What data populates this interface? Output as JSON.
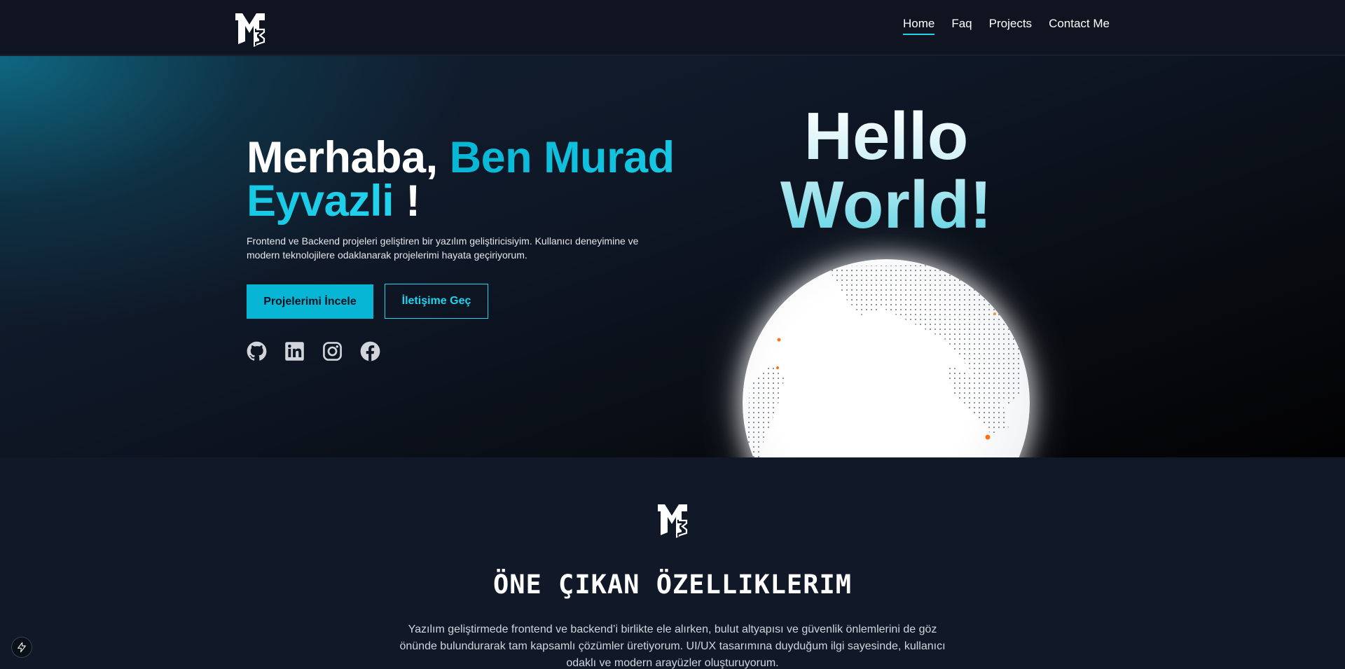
{
  "header": {
    "logo_icon": "mb-monogram-logo",
    "nav": [
      {
        "label": "Home",
        "active": true
      },
      {
        "label": "Faq",
        "active": false
      },
      {
        "label": "Projects",
        "active": false
      },
      {
        "label": "Contact Me",
        "active": false
      }
    ]
  },
  "hero": {
    "title_prefix": "Merhaba,",
    "title_name": "Ben Murad Eyvazli",
    "title_suffix": "!",
    "description": "Frontend ve Backend projeleri geliştiren bir yazılım geliştiricisiyim. Kullanıcı deneyimine ve modern teknolojilere odaklanarak projelerimi hayata geçiriyorum.",
    "primary_button": "Projelerimi İncele",
    "secondary_button": "İletişime Geç",
    "socials": [
      "github-icon",
      "linkedin-icon",
      "instagram-icon",
      "facebook-icon"
    ],
    "hello_line1": "Hello",
    "hello_line2": "World!",
    "accent_color": "#22d3ee"
  },
  "features": {
    "logo_icon": "mb-monogram-logo",
    "title": "ÖNE ÇIKAN ÖZELLIKLERIM",
    "description": "Yazılım geliştirmede frontend ve backend’i birlikte ele alırken, bulut altyapısı ve güvenlik önlemlerini de göz önünde bulundurarak tam kapsamlı çözümler üretiyorum. UI/UX tasarımına duyduğum ilgi sayesinde, kullanıcı odaklı ve modern arayüzler oluşturuyorum."
  },
  "floating_button_icon": "lightning-bolt-icon"
}
